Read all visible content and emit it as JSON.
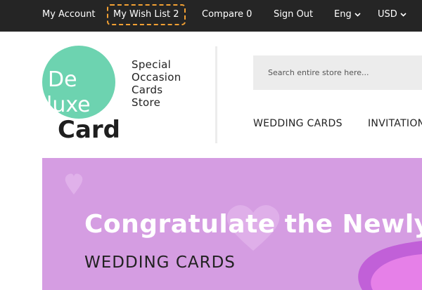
{
  "topbar": {
    "my_account": "My Account",
    "wish_list": "My Wish List 2",
    "compare": "Compare 0",
    "sign_out": "Sign Out",
    "language": "Eng",
    "currency": "USD"
  },
  "logo": {
    "line1": "De",
    "line2": "luxe",
    "line3": "Card",
    "circle_color": "#6dd3b0"
  },
  "store_name": {
    "line1": "Special",
    "line2": "Occasion",
    "line3": "Cards",
    "line4": "Store"
  },
  "search": {
    "placeholder": "Search entire store here..."
  },
  "nav": {
    "items": [
      {
        "label": "WEDDING CARDS"
      },
      {
        "label": "INVITATION"
      }
    ]
  },
  "banner": {
    "title": "Congratulate the Newly-",
    "subtitle": "WEDDING CARDS",
    "background_color": "#d59de2"
  },
  "icons": {
    "chevron": "chevron-down-icon",
    "heart": "heart-icon"
  }
}
